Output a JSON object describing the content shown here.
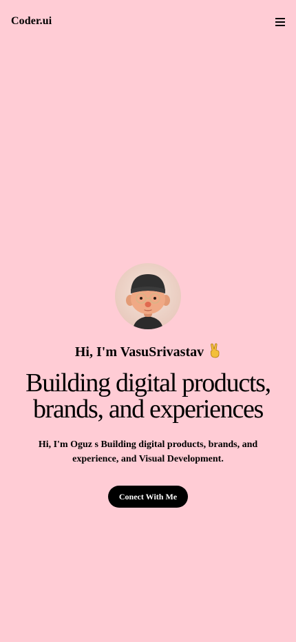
{
  "header": {
    "brand": "Coder.ui",
    "menu_icon": "hamburger-menu-icon"
  },
  "hero": {
    "avatar_icon": "memoji-avatar",
    "greeting": "Hi, I'm VasuSrivastav",
    "greeting_emoji": "victory-hand-icon",
    "headline_line1": "Building digital products,",
    "headline_line2": "brands, and experiences",
    "intro": "Hi, I'm Oguz s Building digital products, brands, and experience, and Visual Development.",
    "cta_label": "Conect With Me"
  },
  "colors": {
    "background": "#ffccd5",
    "button": "#000000",
    "button_text": "#ffffff"
  }
}
